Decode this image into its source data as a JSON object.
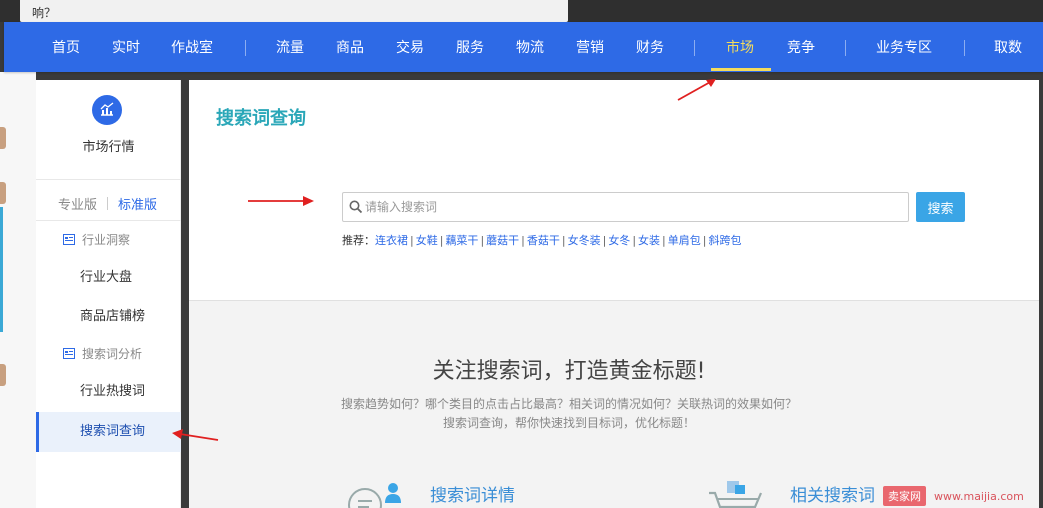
{
  "top_strip": {
    "text": "响？"
  },
  "nav": {
    "items": [
      "首页",
      "实时",
      "作战室",
      "流量",
      "商品",
      "交易",
      "服务",
      "物流",
      "营销",
      "财务",
      "市场",
      "竞争",
      "业务专区",
      "取数"
    ],
    "active": "市场"
  },
  "sidebar": {
    "title": "市场行情",
    "versions": [
      "专业版",
      "标准版"
    ],
    "sections": [
      {
        "label": "行业洞察",
        "links": [
          "行业大盘",
          "商品店铺榜"
        ]
      },
      {
        "label": "搜索词分析",
        "links": [
          "行业热搜词",
          "搜索词查询"
        ]
      }
    ],
    "active_link": "搜索词查询"
  },
  "main": {
    "title": "搜索词查询",
    "search": {
      "placeholder": "请输入搜索词",
      "value": ""
    },
    "search_button": "搜索",
    "recommend_label": "推荐：",
    "recommend_terms": [
      "连衣裙",
      "女鞋",
      "藕菜干",
      "蘑菇干",
      "香菇干",
      "女冬装",
      "女冬",
      "女装",
      "单肩包",
      "斜跨包"
    ],
    "slogan": "关注搜索词，打造黄金标题!",
    "description_line1": "搜索趋势如何？哪个类目的点击占比最高？相关词的情况如何？关联热词的效果如何？",
    "description_line2": "搜索词查询，帮你快速找到目标词，优化标题！",
    "features": [
      "搜索词详情",
      "相关搜索词"
    ]
  },
  "watermark": {
    "badge": "卖家网",
    "url": "www.maijia.com"
  },
  "colors": {
    "nav": "#2e6ae6",
    "active_nav": "#f4dc5c",
    "title": "#2aa7b8",
    "button": "#3aa5e6",
    "annotation": "#e02020"
  }
}
